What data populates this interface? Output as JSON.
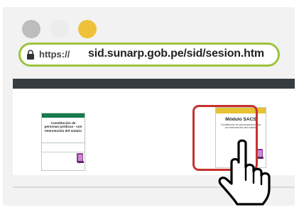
{
  "browser": {
    "window_buttons": [
      "gray",
      "light-gray",
      "yellow"
    ],
    "url_protocol": "https://",
    "url_host": "sid.sunarp.gob.pe/sid/sesion.htm"
  },
  "page": {
    "card_left": {
      "title": "Constitución de personas jurídicas - con intervención del notario"
    },
    "card_right": {
      "title": "Módulo SACS",
      "subtitle": "Constitución de personas jurídicas sin intervención del notario"
    }
  },
  "colors": {
    "accent_green": "#9dc43a",
    "card_left_bar": "#177a4b",
    "card_right_bar": "#e7c233",
    "highlight_red": "#c7312c",
    "dark_bar": "#353d42"
  },
  "icons": {
    "lock": "lock-icon",
    "book": "book-icon",
    "cursor": "pointing-hand-cursor-icon"
  }
}
